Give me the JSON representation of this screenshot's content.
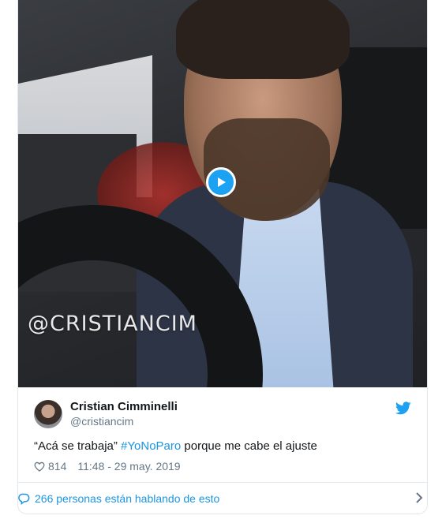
{
  "video": {
    "watermark": "@CRISTIANCIM"
  },
  "tweet": {
    "author_name": "Cristian Cimminelli",
    "author_handle": "@cristiancim",
    "text_before": "“Acá se trabaja” ",
    "hashtag": "#YoNoParo",
    "text_after": " porque me cabe el ajuste",
    "likes": "814",
    "timestamp": "11:48 - 29 may. 2019"
  },
  "conversation": {
    "label": "266 personas están hablando de esto"
  },
  "colors": {
    "accent": "#1da1f2",
    "link": "#1b95e0",
    "secondary_text": "#657786",
    "border": "#e1e8ed"
  },
  "icons": {
    "play": "play-icon",
    "bird": "twitter-bird-icon",
    "heart": "heart-icon",
    "comment": "comment-icon",
    "chevron": "chevron-right-icon"
  }
}
